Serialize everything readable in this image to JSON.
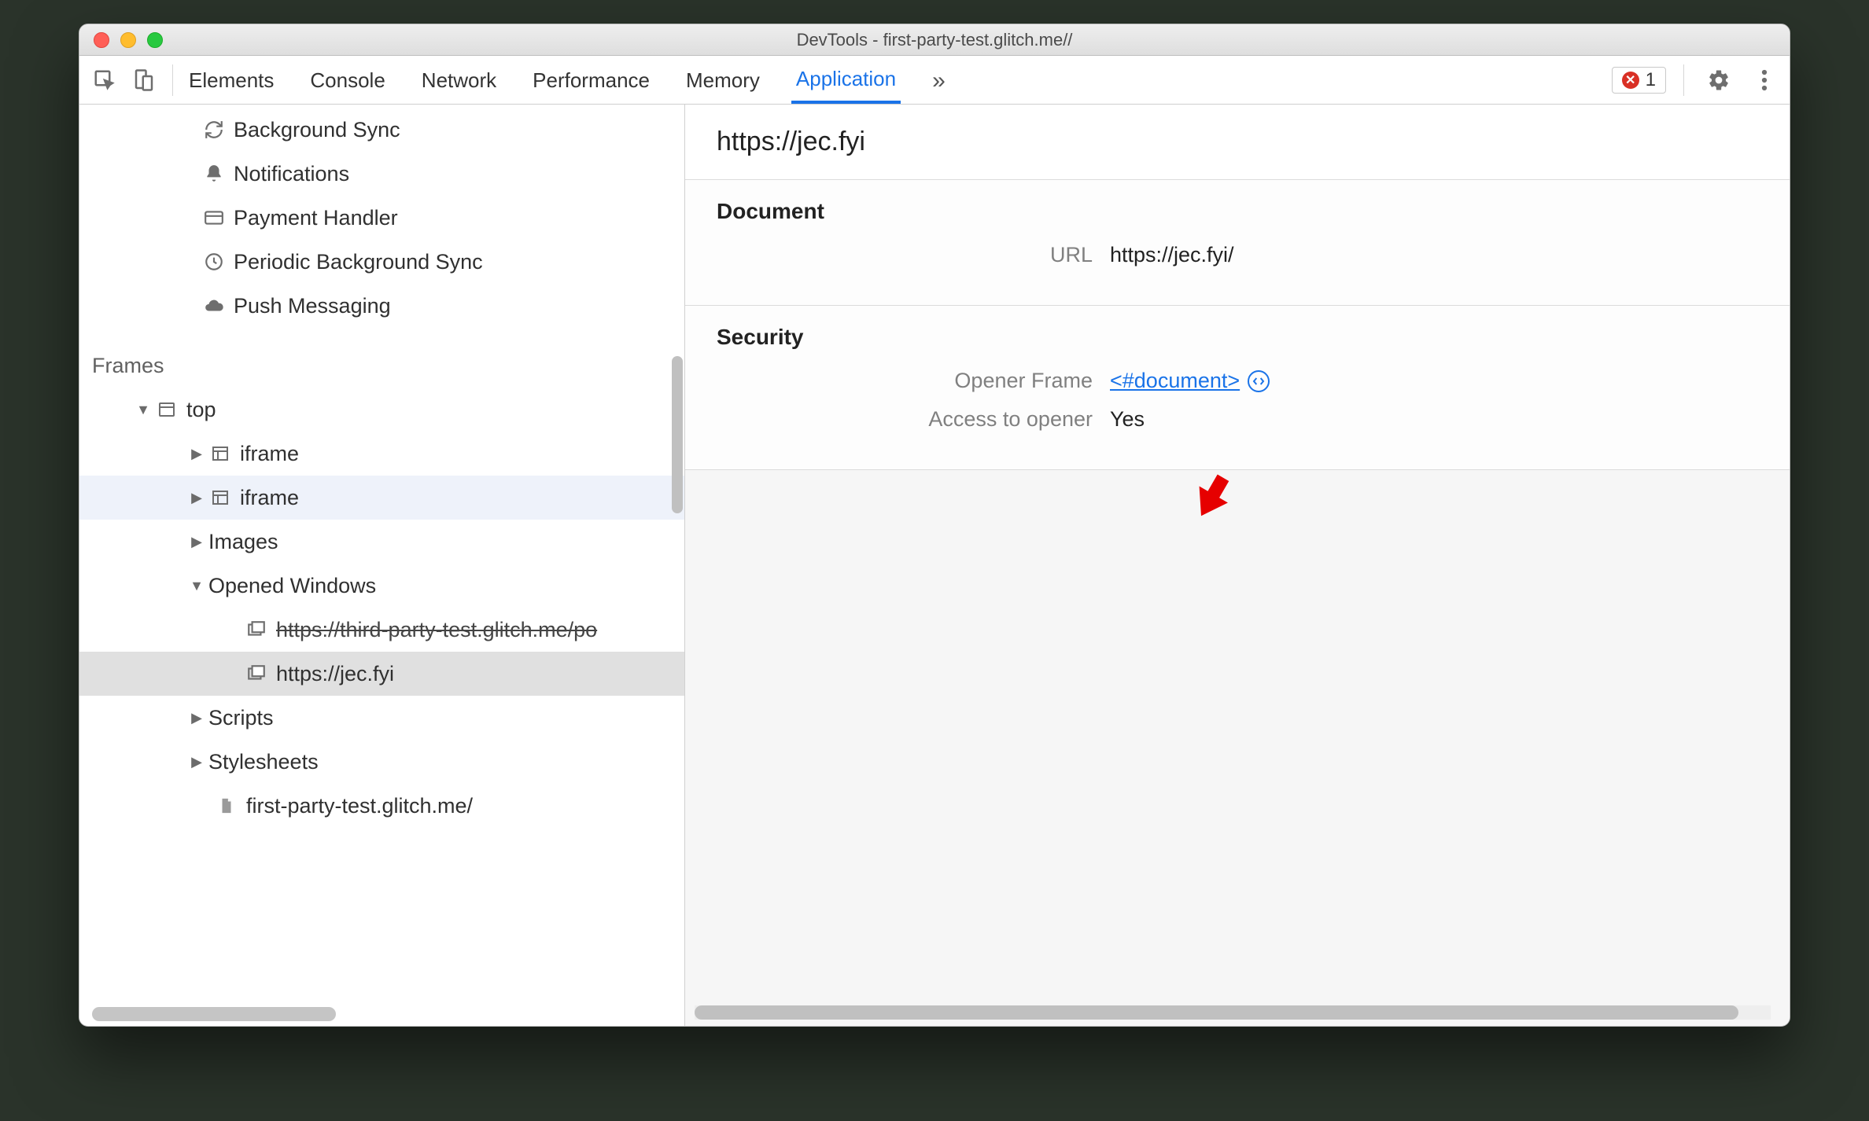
{
  "window": {
    "title": "DevTools - first-party-test.glitch.me//"
  },
  "toolbar": {
    "tabs": [
      "Elements",
      "Console",
      "Network",
      "Performance",
      "Memory",
      "Application"
    ],
    "active_tab": "Application",
    "overflow": "»",
    "error_count": "1"
  },
  "sidebar": {
    "bg_items": [
      {
        "icon": "sync-icon",
        "label": "Background Sync"
      },
      {
        "icon": "bell-icon",
        "label": "Notifications"
      },
      {
        "icon": "card-icon",
        "label": "Payment Handler"
      },
      {
        "icon": "clock-icon",
        "label": "Periodic Background Sync"
      },
      {
        "icon": "cloud-icon",
        "label": "Push Messaging"
      }
    ],
    "frames_label": "Frames",
    "tree": {
      "top": "top",
      "iframe1": "iframe",
      "iframe2": "iframe",
      "images": "Images",
      "opened": "Opened Windows",
      "win1": "https://third-party-test.glitch.me/po",
      "win2": "https://jec.fyi",
      "scripts": "Scripts",
      "stylesheets": "Stylesheets",
      "docfile": "first-party-test.glitch.me/"
    }
  },
  "main": {
    "title": "https://jec.fyi",
    "document_section": "Document",
    "url_label": "URL",
    "url_value": "https://jec.fyi/",
    "security_section": "Security",
    "opener_label": "Opener Frame",
    "opener_value": "<#document>",
    "access_label": "Access to opener",
    "access_value": "Yes"
  }
}
